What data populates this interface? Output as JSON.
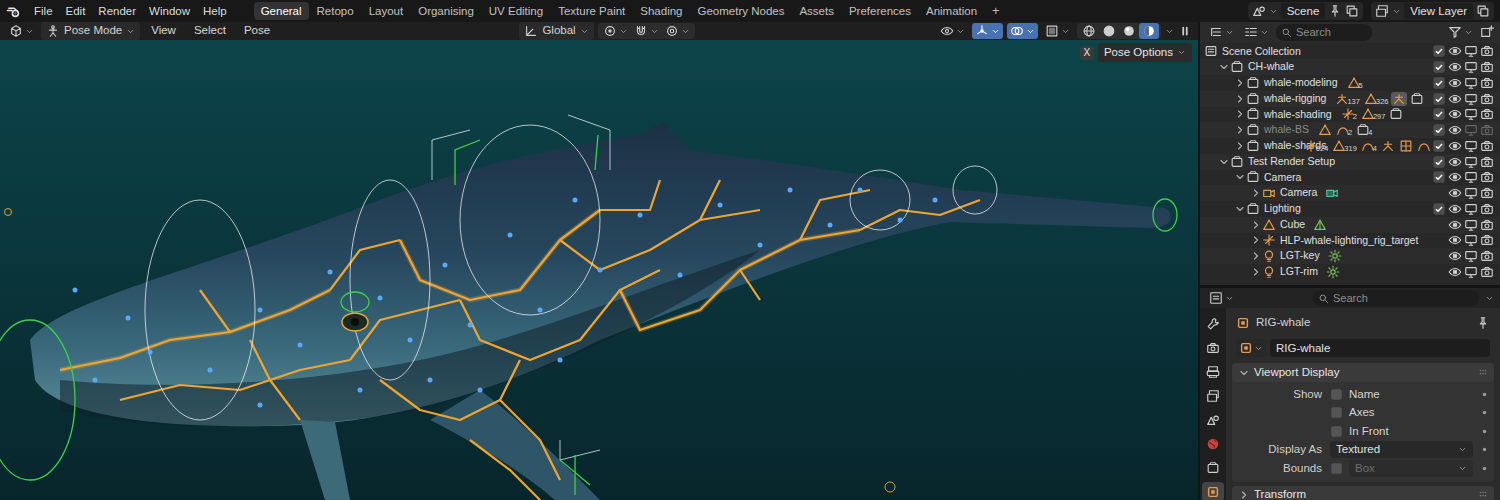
{
  "menu": [
    "File",
    "Edit",
    "Render",
    "Window",
    "Help"
  ],
  "workspaces": [
    {
      "label": "General",
      "selected": true
    },
    {
      "label": "Retopo",
      "selected": false
    },
    {
      "label": "Layout",
      "selected": false
    },
    {
      "label": "Organising",
      "selected": false
    },
    {
      "label": "UV Editing",
      "selected": false
    },
    {
      "label": "Texture Paint",
      "selected": false
    },
    {
      "label": "Shading",
      "selected": false
    },
    {
      "label": "Geometry Nodes",
      "selected": false
    },
    {
      "label": "Assets",
      "selected": false
    },
    {
      "label": "Preferences",
      "selected": false
    },
    {
      "label": "Animation",
      "selected": false
    }
  ],
  "add_workspace": "+",
  "scene": "Scene",
  "view_layer": "View Layer",
  "viewport": {
    "mode": "Pose Mode",
    "menus": [
      "View",
      "Select",
      "Pose"
    ],
    "orientation": "Global",
    "tools": [
      {
        "kind": "pivot",
        "on": false
      },
      {
        "kind": "magnet",
        "on": false
      },
      {
        "kind": "proportional",
        "on": false
      }
    ],
    "toggles": [
      {
        "kind": "visibility",
        "on": false
      },
      {
        "kind": "gizmo",
        "on": true
      },
      {
        "kind": "overlay",
        "on": true
      },
      {
        "kind": "xray",
        "on": false
      }
    ],
    "shading": [
      {
        "kind": "wireframe",
        "selected": false
      },
      {
        "kind": "solid",
        "selected": false
      },
      {
        "kind": "material",
        "selected": false
      },
      {
        "kind": "rendered",
        "selected": true
      }
    ],
    "xray_button": "X",
    "pose_options": "Pose Options"
  },
  "outliner": {
    "search": {
      "placeholder": "Search"
    },
    "tree": [
      {
        "label": "Scene Collection",
        "kind": "scene_collection",
        "checked": true,
        "visible": true,
        "viewport": true,
        "render": true,
        "children": [
          {
            "label": "CH-whale",
            "kind": "collection",
            "expanded": true,
            "checked": true,
            "visible": true,
            "viewport": true,
            "render": true,
            "children": [
              {
                "label": "whale-modeling",
                "kind": "collection",
                "expanded": false,
                "checked": true,
                "visible": true,
                "viewport": true,
                "render": true,
                "badges": [
                  {
                    "kind": "mesh",
                    "count": "5",
                    "selected": false
                  }
                ]
              },
              {
                "label": "whale-rigging",
                "kind": "collection",
                "expanded": false,
                "checked": true,
                "visible": true,
                "viewport": true,
                "render": true,
                "badges": [
                  {
                    "kind": "armature",
                    "count": "137",
                    "selected": false
                  },
                  {
                    "kind": "mesh",
                    "count": "326",
                    "selected": false
                  },
                  {
                    "kind": "armature",
                    "selected": true
                  },
                  {
                    "kind": "collection",
                    "selected": false
                  }
                ]
              },
              {
                "label": "whale-shading",
                "kind": "collection",
                "expanded": false,
                "checked": true,
                "visible": true,
                "viewport": true,
                "render": true,
                "badges": [
                  {
                    "kind": "empty",
                    "count": "2",
                    "selected": false
                  },
                  {
                    "kind": "mesh",
                    "count": "297",
                    "selected": false
                  },
                  {
                    "kind": "collection",
                    "selected": false
                  }
                ]
              },
              {
                "label": "whale-BS",
                "kind": "collection",
                "expanded": false,
                "checked": true,
                "visible": true,
                "viewport": false,
                "render": false,
                "badges": [
                  {
                    "kind": "mesh",
                    "selected": false
                  },
                  {
                    "kind": "curve",
                    "count": "2",
                    "selected": false
                  },
                  {
                    "kind": "collection",
                    "count": "4",
                    "selected": false
                  }
                ]
              },
              {
                "label": "whale-shards",
                "kind": "collection",
                "expanded": false,
                "checked": true,
                "visible": true,
                "viewport": true,
                "render": true,
                "badges": [
                  {
                    "kind": "empty",
                    "count": "624",
                    "selected": false
                  },
                  {
                    "kind": "mesh",
                    "count": "319",
                    "selected": false
                  },
                  {
                    "kind": "curve",
                    "count": "4",
                    "selected": false
                  },
                  {
                    "kind": "armature",
                    "selected": false
                  },
                  {
                    "kind": "lattice",
                    "selected": false
                  },
                  {
                    "kind": "curve",
                    "selected": false
                  }
                ]
              }
            ]
          },
          {
            "label": "Test Render Setup",
            "kind": "collection",
            "expanded": true,
            "checked": true,
            "visible": true,
            "viewport": true,
            "render": true,
            "children": [
              {
                "label": "Camera",
                "kind": "collection",
                "expanded": true,
                "checked": true,
                "visible": true,
                "viewport": true,
                "render": true,
                "children": [
                  {
                    "label": "Camera",
                    "kind": "camera",
                    "expanded": false,
                    "visible": true,
                    "viewport": true,
                    "render": true,
                    "data": "camera_data"
                  }
                ]
              },
              {
                "label": "Lighting",
                "kind": "collection",
                "expanded": true,
                "checked": true,
                "visible": true,
                "viewport": true,
                "render": true,
                "children": [
                  {
                    "label": "Cube",
                    "kind": "mesh",
                    "expanded": false,
                    "visible": true,
                    "viewport": true,
                    "render": true,
                    "data": "mesh_data"
                  },
                  {
                    "label": "HLP-whale-lighting_rig_target",
                    "kind": "empty",
                    "expanded": false,
                    "visible": true,
                    "viewport": true,
                    "render": true
                  },
                  {
                    "label": "LGT-key",
                    "kind": "light",
                    "expanded": false,
                    "visible": true,
                    "viewport": true,
                    "render": true,
                    "data": "light_data"
                  },
                  {
                    "label": "LGT-rim",
                    "kind": "light",
                    "expanded": false,
                    "visible": true,
                    "viewport": true,
                    "render": true,
                    "data": "light_data"
                  }
                ]
              }
            ]
          }
        ]
      }
    ]
  },
  "properties": {
    "search": {
      "placeholder": "Search"
    },
    "tabs": [
      {
        "kind": "tool",
        "selected": false
      },
      {
        "kind": "render",
        "selected": false
      },
      {
        "kind": "output",
        "selected": false
      },
      {
        "kind": "view_layer",
        "selected": false
      },
      {
        "kind": "scene",
        "selected": false
      },
      {
        "kind": "world",
        "selected": false
      },
      {
        "kind": "collection",
        "selected": false
      },
      {
        "kind": "object",
        "selected": true
      }
    ],
    "object": "RIG-whale",
    "name_field": "RIG-whale",
    "panels": [
      {
        "title": "Viewport Display",
        "expanded": true,
        "rows": [
          {
            "kind": "check",
            "label": "Show",
            "text": "Name",
            "checked": false
          },
          {
            "kind": "check",
            "text": "Axes",
            "checked": false
          },
          {
            "kind": "check",
            "text": "In Front",
            "checked": false
          },
          {
            "kind": "select",
            "label": "Display As",
            "value": "Textured"
          },
          {
            "kind": "checkselect",
            "label": "Bounds",
            "checked": false,
            "value": "Box",
            "disabled": true
          }
        ]
      },
      {
        "title": "Transform",
        "expanded": false
      }
    ]
  }
}
